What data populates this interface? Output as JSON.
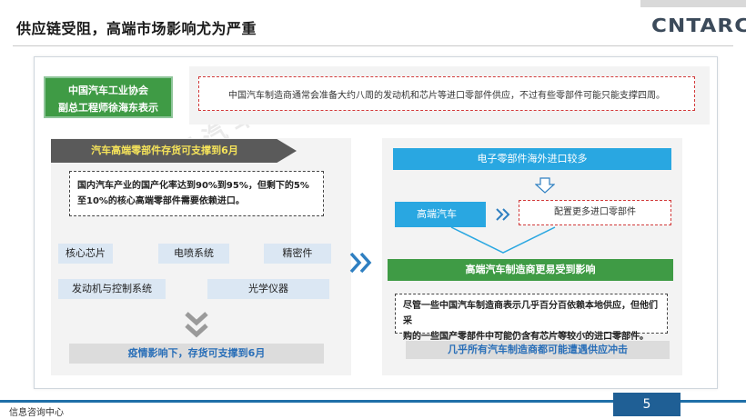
{
  "slide": {
    "title": "供应链受阻，高端市场影响尤为严重",
    "logo": "CNTARC",
    "footer_label": "信息咨询中心",
    "page_number": "5"
  },
  "speaker": {
    "line1": "中国汽车工业协会",
    "line2": "副总工程师徐海东表示"
  },
  "quote": "中国汽车制造商通常会准备大约八周的发动机和芯片等进口零部件供应，不过有些零部件可能只能支撑四周。",
  "left": {
    "banner": "汽车高端零部件存货可支撑到6月",
    "stat_line1": "国内汽车产业的国产化率达到90%到95%，但剩下的5%",
    "stat_line2": "至10%的核心高端零部件需要依赖进口。",
    "parts": [
      "核心芯片",
      "电喷系统",
      "精密件",
      "发动机与控制系统",
      "光学仪器"
    ],
    "pandemic": "疫情影响下，存货可支撑到6月"
  },
  "right": {
    "import_label": "电子零部件海外进口较多",
    "highend_label": "高端汽车",
    "config_label": "配置更多进口零部件",
    "impact_label": "高端汽车制造商更易受到影响",
    "detail_line1": "尽管一些中国汽车制造商表示几乎百分百依赖本地供应，但他们采",
    "detail_line2": "购的一些国产零部件中可能仍含有芯片等较小的进口零部件。",
    "supply_label": "几乎所有汽车制造商都可能遭遇供应冲击"
  },
  "colors": {
    "green": "#3f9b45",
    "blue": "#29a7e1",
    "dark_blue": "#1f5f95",
    "red_dash": "#d23a3a",
    "banner_text": "#f5e35a"
  }
}
